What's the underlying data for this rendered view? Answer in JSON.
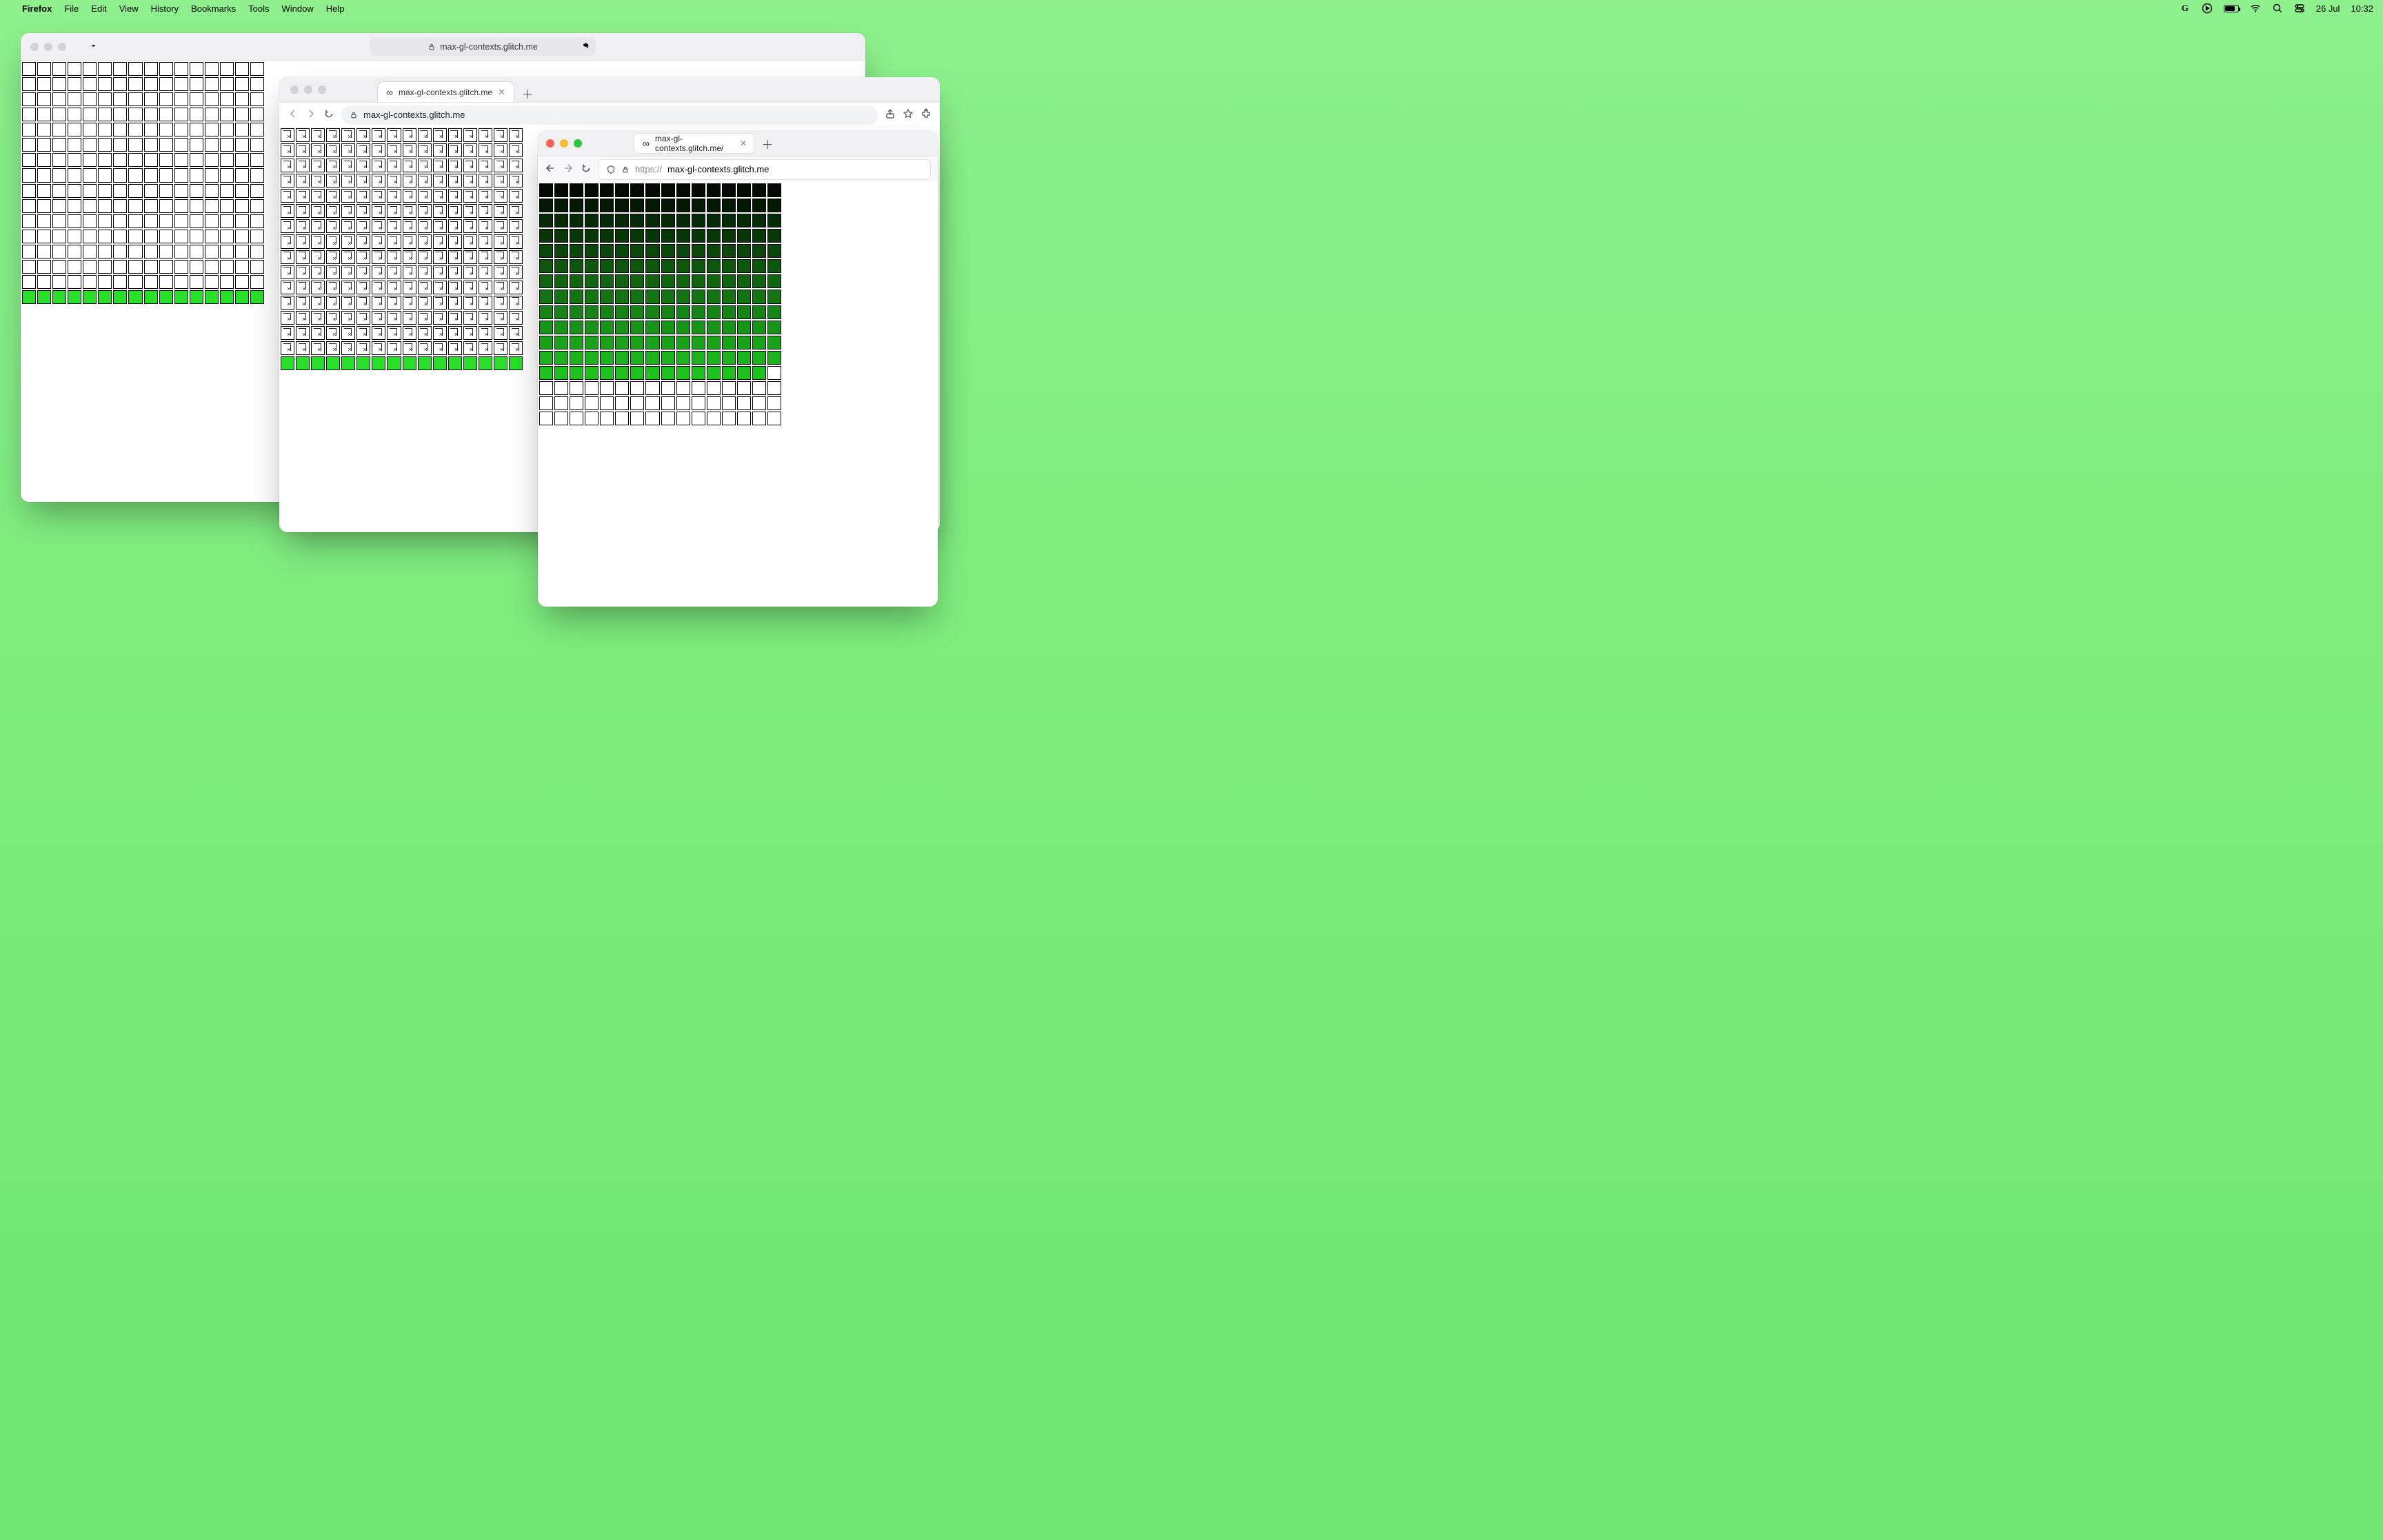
{
  "menubar": {
    "app": "Firefox",
    "items": [
      "File",
      "Edit",
      "View",
      "History",
      "Bookmarks",
      "Tools",
      "Window",
      "Help"
    ],
    "date": "26 Jul",
    "time": "10:32"
  },
  "safari": {
    "address": "max-gl-contexts.glitch.me",
    "grid": {
      "cols": 16,
      "rows": 16,
      "lime_row_count": 1
    }
  },
  "chrome": {
    "tab_title": "max-gl-contexts.glitch.me",
    "address": "max-gl-contexts.glitch.me",
    "grid": {
      "cols": 16,
      "rows": 16,
      "lime_row_count": 1
    }
  },
  "firefox": {
    "tab_title": "max-gl-contexts.glitch.me/",
    "url_prefix": "https://",
    "url_host": "max-gl-contexts.glitch.me",
    "grid": {
      "cols": 16,
      "rows": 16,
      "gradient_filled": 207
    }
  }
}
